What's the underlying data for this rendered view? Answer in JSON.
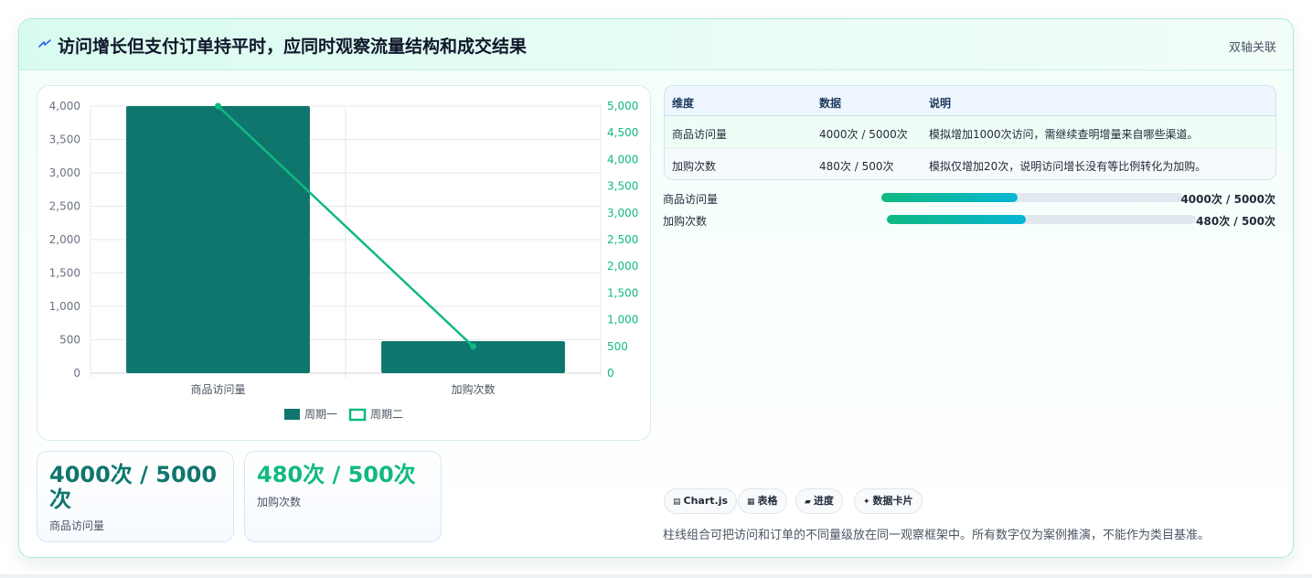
{
  "header": {
    "title": "访问增长但支付订单持平时，应同时观察流量结构和成交结果",
    "tag": "双轴关联"
  },
  "colors": {
    "bar": "#0f766e",
    "line": "#10b981",
    "accent_border": "#a7ecd8"
  },
  "chart_data": {
    "type": "bar",
    "categories": [
      "商品访问量",
      "加购次数"
    ],
    "series": [
      {
        "name": "周期一",
        "type": "bar",
        "axis": "left",
        "values": [
          4000,
          480
        ]
      },
      {
        "name": "周期二",
        "type": "line",
        "axis": "right",
        "values": [
          5000,
          500
        ]
      }
    ],
    "y_left": {
      "range": [
        0,
        4000
      ],
      "ticks": [
        "0",
        "500",
        "1,000",
        "1,500",
        "2,000",
        "2,500",
        "3,000",
        "3,500",
        "4,000"
      ]
    },
    "y_right": {
      "range": [
        0,
        5000
      ],
      "ticks": [
        "0",
        "500",
        "1,000",
        "1,500",
        "2,000",
        "2,500",
        "3,000",
        "3,500",
        "4,000",
        "4,500",
        "5,000"
      ]
    },
    "grid": true,
    "legend": "bottom"
  },
  "kpis": [
    {
      "value": "4000次 / 5000次",
      "label": "商品访问量"
    },
    {
      "value": "480次 / 500次",
      "label": "加购次数"
    }
  ],
  "table": {
    "headers": [
      "维度",
      "数据",
      "说明"
    ],
    "rows": [
      [
        "商品访问量",
        "4000次 / 5000次",
        "模拟增加1000次访问，需继续查明增量来自哪些渠道。"
      ],
      [
        "加购次数",
        "480次 / 500次",
        "模拟仅增加20次，说明访问增长没有等比例转化为加购。"
      ]
    ]
  },
  "progress": [
    {
      "label": "商品访问量",
      "value": "4000次 / 5000次",
      "fraction": 0.45
    },
    {
      "label": "加购次数",
      "value": "480次 / 500次",
      "fraction": 0.45
    }
  ],
  "chips": [
    {
      "icon": "chart-icon",
      "glyph": "▤",
      "label": "Chart.js"
    },
    {
      "icon": "table-icon",
      "glyph": "▦",
      "label": "表格"
    },
    {
      "icon": "progress-icon",
      "glyph": "▰",
      "label": "进度"
    },
    {
      "icon": "sparkle-icon",
      "glyph": "✦",
      "label": "数据卡片"
    }
  ],
  "footnote": "柱线组合可把访问和订单的不同量级放在同一观察框架中。所有数字仅为案例推演，不能作为类目基准。"
}
